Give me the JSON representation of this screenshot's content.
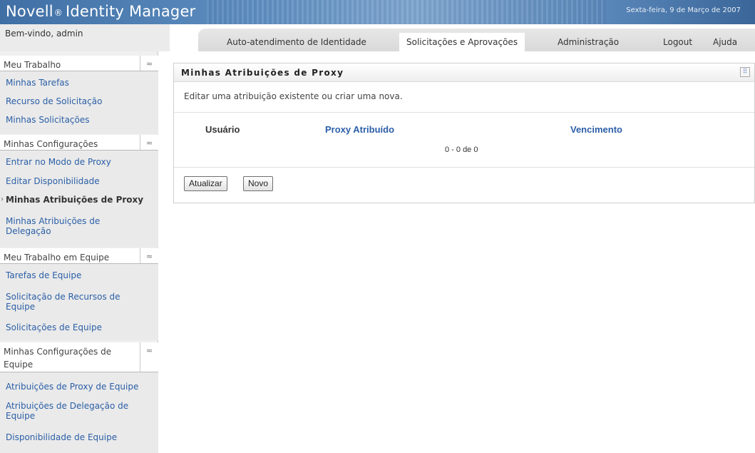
{
  "header": {
    "app_name": "Novell",
    "registered_mark": "®",
    "app_product": "Identity Manager",
    "date": "Sexta-feira, 9 de Março de 2007"
  },
  "nav": {
    "welcome": "Bem-vindo, admin",
    "tabs": [
      {
        "label": "Auto-atendimento de Identidade",
        "active": false
      },
      {
        "label": "Solicitações e Aprovações",
        "active": true
      },
      {
        "label": "Administração",
        "active": false
      },
      {
        "label": "Logout",
        "active": false
      },
      {
        "label": "Ajuda",
        "active": false
      }
    ]
  },
  "sidebar": {
    "sections": [
      {
        "title": "Meu Trabalho",
        "items": [
          "Minhas Tarefas",
          "Recurso de Solicitação",
          "Minhas Solicitações"
        ]
      },
      {
        "title": "Minhas Configurações",
        "items": [
          "Entrar no Modo de Proxy",
          "Editar Disponibilidade",
          "Minhas Atribuições de Proxy",
          "Minhas Atribuições de Delegação"
        ]
      },
      {
        "title": "Meu Trabalho em Equipe",
        "items": [
          "Tarefas de Equipe",
          "Solicitação de Recursos de Equipe",
          "Solicitações de Equipe"
        ]
      },
      {
        "title": "Minhas Configurações de Equipe",
        "items": [
          "Atribuições de Proxy de Equipe",
          "Atribuições de Delegação de Equipe",
          "Disponibilidade de Equipe"
        ]
      }
    ],
    "collapse_glyph": "≈",
    "current_bullet": "›"
  },
  "panel": {
    "title": "Minhas Atribuições de Proxy",
    "help_icon": "grid-help-icon",
    "description": "Editar uma atribuição existente ou criar uma nova.",
    "columns": [
      "Usuário",
      "Proxy Atribuído",
      "Vencimento"
    ],
    "count": "0 - 0 de 0",
    "buttons": {
      "refresh": "Atualizar",
      "new": "Novo"
    }
  },
  "colors": {
    "banner": "#4f7db3",
    "link": "#2b5fa6",
    "sidebar_bg": "#eaeaea"
  }
}
